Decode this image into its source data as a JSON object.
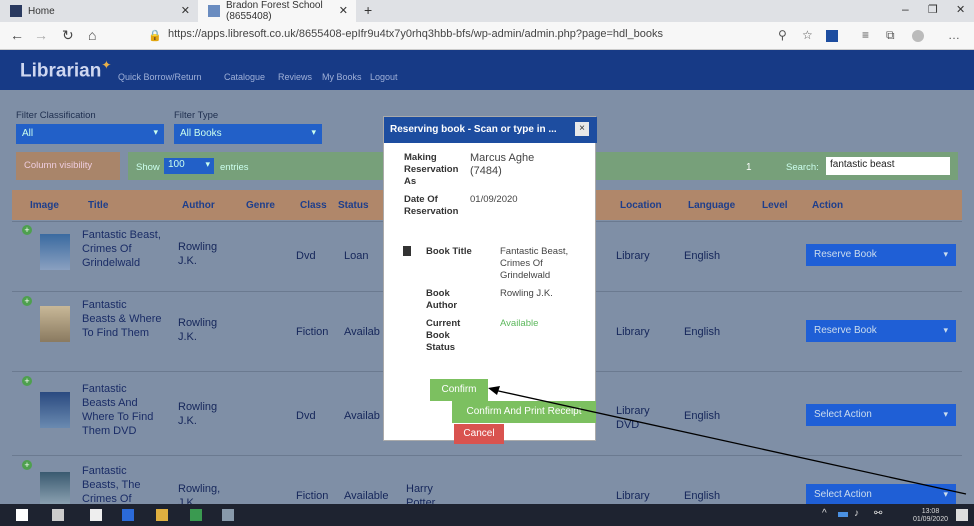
{
  "browser": {
    "tabs": [
      {
        "label": "Home"
      },
      {
        "label": "Bradon Forest School (8655408)"
      }
    ],
    "url": "https://apps.libresoft.co.uk/8655408-epIfr9u4tx7y0rhq3hbb-bfs/wp-admin/admin.php?page=hdl_books"
  },
  "nav": {
    "brand": "Librarian",
    "links": [
      "Quick Borrow/Return",
      "Catalogue",
      "Reviews",
      "My Books",
      "Logout"
    ]
  },
  "filters": {
    "classification_label": "Filter Classification",
    "classification_value": "All",
    "type_label": "Filter Type",
    "type_value": "All Books"
  },
  "toolbar": {
    "column_visibility": "Column visibility",
    "show": "Show",
    "entries_value": "100",
    "entries": "entries",
    "page_num": "1",
    "search_label": "Search:",
    "search_value": "fantastic beast"
  },
  "table": {
    "headers": [
      "Image",
      "Title",
      "Author",
      "Genre",
      "Class",
      "Status",
      "Location",
      "Language",
      "Level",
      "Action"
    ],
    "rows": [
      {
        "title": "Fantastic Beast, Crimes Of Grindelwald",
        "author": "Rowling J.K.",
        "class": "Dvd",
        "status": "Loan",
        "location": "Library",
        "language": "English",
        "action": "Reserve Book"
      },
      {
        "title": "Fantastic Beasts & Where To Find Them",
        "author": "Rowling J.K.",
        "class": "Fiction",
        "status": "Availab",
        "location": "Library",
        "language": "English",
        "action": "Reserve Book"
      },
      {
        "title": "Fantastic Beasts And Where To Find Them DVD",
        "author": "Rowling J.K.",
        "class": "Dvd",
        "status": "Availab",
        "location": "Library DVD",
        "language": "English",
        "action": "Select Action"
      },
      {
        "title": "Fantastic Beasts, The Crimes Of",
        "author": "Rowling, J.K.",
        "class": "Fiction",
        "status": "Available",
        "genre": "Harry Potter",
        "location": "Library",
        "language": "English",
        "action": "Select Action"
      }
    ]
  },
  "modal": {
    "title": "Reserving book - Scan or type in ...",
    "close": "×",
    "making_label": "Making Reservation As",
    "making_value": "Marcus Aghe (7484)",
    "date_label": "Date Of Reservation",
    "date_value": "01/09/2020",
    "book_title_label": "Book Title",
    "book_title_value": "Fantastic Beast, Crimes Of Grindelwald",
    "book_author_label": "Book Author",
    "book_author_value": "Rowling J.K.",
    "status_label": "Current Book Status",
    "status_value": "Available",
    "confirm": "Confirm",
    "confirm_print": "Confirm And Print Receipt",
    "cancel": "Cancel"
  },
  "taskbar": {
    "time": "13:08",
    "date": "01/09/2020"
  },
  "colors": {
    "nav_bg": "#173a86",
    "button_blue": "#1f5fd6",
    "confirm_green": "#7cc060",
    "cancel_red": "#d9534f",
    "header_brown": "#b0876a"
  }
}
